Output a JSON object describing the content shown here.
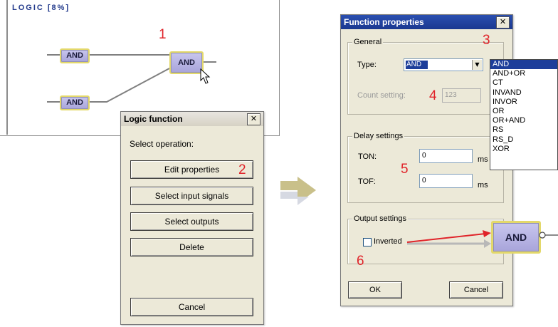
{
  "canvas": {
    "title": "LOGIC  [8%]",
    "gates": {
      "in1": "AND",
      "in2": "AND",
      "out": "AND"
    }
  },
  "steps": {
    "s1": "1",
    "s2": "2",
    "s3": "3",
    "s4": "4",
    "s5": "5",
    "s6": "6"
  },
  "logic_dialog": {
    "title": "Logic function",
    "prompt": "Select operation:",
    "buttons": {
      "edit": "Edit properties",
      "inputs": "Select input signals",
      "outputs": "Select outputs",
      "delete": "Delete",
      "cancel": "Cancel"
    }
  },
  "props_dialog": {
    "title": "Function properties",
    "general": {
      "group": "General",
      "type_label": "Type:",
      "type_value": "AND",
      "count_label": "Count setting:",
      "count_value": "123"
    },
    "delay": {
      "group": "Delay settings",
      "ton_label": "TON:",
      "ton_value": "0",
      "ton_unit": "ms",
      "tof_label": "TOF:",
      "tof_value": "0",
      "tof_unit": "ms"
    },
    "output": {
      "group": "Output settings",
      "inverted_label": "Inverted",
      "preview_gate": "AND"
    },
    "ok": "OK",
    "cancel": "Cancel"
  },
  "type_options": [
    "AND",
    "AND+OR",
    "CT",
    "INVAND",
    "INVOR",
    "OR",
    "OR+AND",
    "RS",
    "RS_D",
    "XOR"
  ],
  "colors": {
    "accent": "#e0242a",
    "selection": "#1d3e9a",
    "gate_fill": "#b8b4e4",
    "gate_border": "#e3d86a",
    "arrow": "#c8c08a"
  }
}
